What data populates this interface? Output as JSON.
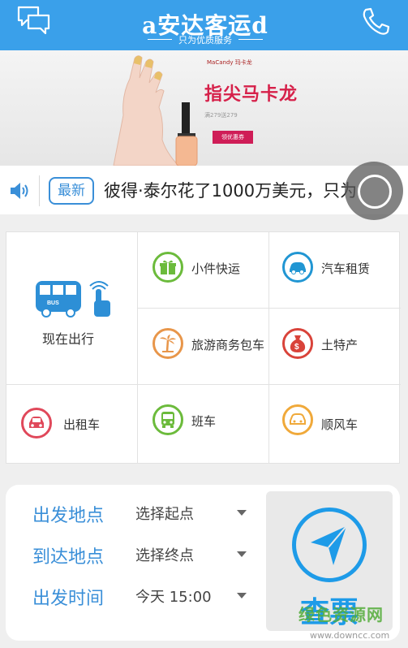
{
  "header": {
    "logo_title": "a安达客运d",
    "logo_subtitle": "只为优质服务"
  },
  "banner": {
    "brand": "MaCandy 玛卡龙",
    "title": "指尖马卡龙",
    "promo_line": "满279送279",
    "promo_box": "领优惠券"
  },
  "news": {
    "badge": "最新",
    "text": "彼得·泰尔花了1000万美元，只为"
  },
  "services": {
    "now_travel": "现在出行",
    "items": [
      {
        "label": "小件快运",
        "icon": "gift-icon",
        "color": "#6cbb3c"
      },
      {
        "label": "汽车租赁",
        "icon": "car-side-icon",
        "color": "#2196d3"
      },
      {
        "label": "旅游商务包车",
        "icon": "palm-tree-icon",
        "color": "#e8964a"
      },
      {
        "label": "土特产",
        "icon": "money-bag-icon",
        "color": "#d9433a"
      },
      {
        "label": "出租车",
        "icon": "taxi-icon",
        "color": "#e0485a"
      },
      {
        "label": "班车",
        "icon": "bus-front-icon",
        "color": "#6cbb3c"
      },
      {
        "label": "顺风车",
        "icon": "car-front-icon",
        "color": "#f0a93a"
      }
    ]
  },
  "search": {
    "from_label": "出发地点",
    "from_value": "选择起点",
    "to_label": "到达地点",
    "to_value": "选择终点",
    "time_label": "出发时间",
    "time_value": "今天 15:00",
    "query_label": "查票"
  },
  "watermark": {
    "main": "绿色资源网",
    "url": "www.downcc.com"
  }
}
